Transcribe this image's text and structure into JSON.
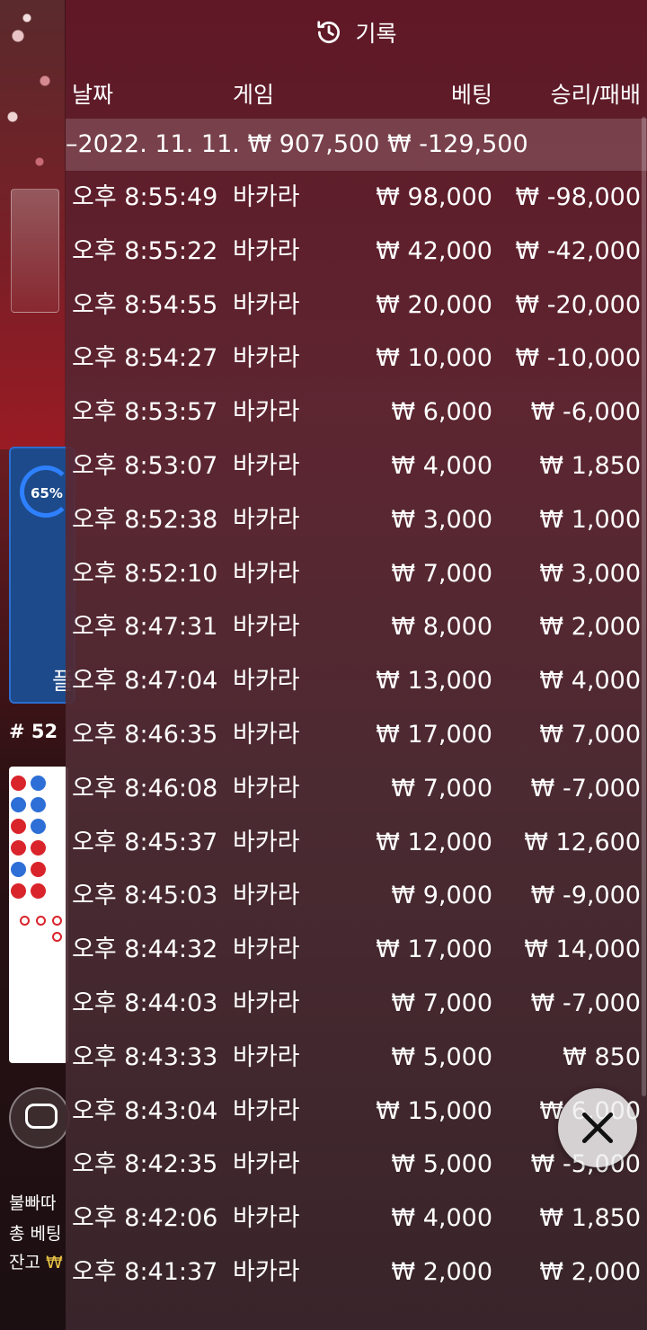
{
  "background": {
    "stats_percent": "65%",
    "panel_char": "플",
    "round_number": "# 52",
    "bottom_line_1": "불빠따",
    "bottom_line_2": "총 베팅",
    "bottom_line_3_label": "잔고",
    "bottom_line_3_value": "₩"
  },
  "history": {
    "title": "기록",
    "icon": "history-clock-icon",
    "columns": {
      "date": "날짜",
      "game": "게임",
      "bet": "베팅",
      "win_loss": "승리/패배"
    },
    "summary": {
      "date": "–2022. 11. 11.",
      "bet": "₩ 907,500",
      "win_loss": "₩ -129,500"
    },
    "rows": [
      {
        "time": "오후 8:55:49",
        "game": "바카라",
        "bet": "₩ 98,000",
        "win_loss": "₩ -98,000"
      },
      {
        "time": "오후 8:55:22",
        "game": "바카라",
        "bet": "₩ 42,000",
        "win_loss": "₩ -42,000"
      },
      {
        "time": "오후 8:54:55",
        "game": "바카라",
        "bet": "₩ 20,000",
        "win_loss": "₩ -20,000"
      },
      {
        "time": "오후 8:54:27",
        "game": "바카라",
        "bet": "₩ 10,000",
        "win_loss": "₩ -10,000"
      },
      {
        "time": "오후 8:53:57",
        "game": "바카라",
        "bet": "₩ 6,000",
        "win_loss": "₩ -6,000"
      },
      {
        "time": "오후 8:53:07",
        "game": "바카라",
        "bet": "₩ 4,000",
        "win_loss": "₩ 1,850"
      },
      {
        "time": "오후 8:52:38",
        "game": "바카라",
        "bet": "₩ 3,000",
        "win_loss": "₩ 1,000"
      },
      {
        "time": "오후 8:52:10",
        "game": "바카라",
        "bet": "₩ 7,000",
        "win_loss": "₩ 3,000"
      },
      {
        "time": "오후 8:47:31",
        "game": "바카라",
        "bet": "₩ 8,000",
        "win_loss": "₩ 2,000"
      },
      {
        "time": "오후 8:47:04",
        "game": "바카라",
        "bet": "₩ 13,000",
        "win_loss": "₩ 4,000"
      },
      {
        "time": "오후 8:46:35",
        "game": "바카라",
        "bet": "₩ 17,000",
        "win_loss": "₩ 7,000"
      },
      {
        "time": "오후 8:46:08",
        "game": "바카라",
        "bet": "₩ 7,000",
        "win_loss": "₩ -7,000"
      },
      {
        "time": "오후 8:45:37",
        "game": "바카라",
        "bet": "₩ 12,000",
        "win_loss": "₩ 12,600"
      },
      {
        "time": "오후 8:45:03",
        "game": "바카라",
        "bet": "₩ 9,000",
        "win_loss": "₩ -9,000"
      },
      {
        "time": "오후 8:44:32",
        "game": "바카라",
        "bet": "₩ 17,000",
        "win_loss": "₩ 14,000"
      },
      {
        "time": "오후 8:44:03",
        "game": "바카라",
        "bet": "₩ 7,000",
        "win_loss": "₩ -7,000"
      },
      {
        "time": "오후 8:43:33",
        "game": "바카라",
        "bet": "₩ 5,000",
        "win_loss": "₩ 850"
      },
      {
        "time": "오후 8:43:04",
        "game": "바카라",
        "bet": "₩ 15,000",
        "win_loss": "₩ 6,000"
      },
      {
        "time": "오후 8:42:35",
        "game": "바카라",
        "bet": "₩ 5,000",
        "win_loss": "₩ -5,000"
      },
      {
        "time": "오후 8:42:06",
        "game": "바카라",
        "bet": "₩ 4,000",
        "win_loss": "₩ 1,850"
      },
      {
        "time": "오후 8:41:37",
        "game": "바카라",
        "bet": "₩ 2,000",
        "win_loss": "₩ 2,000"
      }
    ]
  },
  "close_button": {
    "icon": "close-icon"
  }
}
